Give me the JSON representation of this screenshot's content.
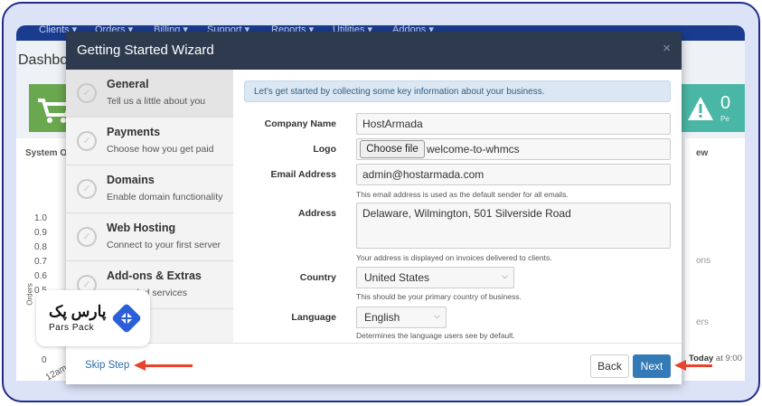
{
  "background": {
    "nav_items": [
      "Clients ▾",
      "Orders ▾",
      "Billing ▾",
      "Support ▾",
      "Reports ▾",
      "Utilities ▾",
      "Addons ▾"
    ],
    "dashboard_title": "Dashboa",
    "system_overview_label": "System O",
    "right_panel_label": "ew",
    "y_axis": [
      "1.0",
      "0.9",
      "0.8",
      "0.7",
      "0.6",
      "0.5"
    ],
    "y_zero": "0",
    "y_axis_title": "Orders",
    "x_first_tick": "12am",
    "right_tile_value": "0",
    "right_tile_sub": "Pe",
    "right_fragments": [
      "ons",
      "ers"
    ],
    "today_label": "Today",
    "today_time": "at 9:00"
  },
  "modal": {
    "title": "Getting Started Wizard",
    "close": "×"
  },
  "steps": [
    {
      "title": "General",
      "desc": "Tell us a little about you",
      "active": true
    },
    {
      "title": "Payments",
      "desc": "Choose how you get paid"
    },
    {
      "title": "Domains",
      "desc": "Enable domain functionality"
    },
    {
      "title": "Web Hosting",
      "desc": "Connect to your first server"
    },
    {
      "title": "Add-ons & Extras",
      "desc": "ded services"
    }
  ],
  "form": {
    "intro": "Let's get started by collecting some key information about your business.",
    "company_label": "Company Name",
    "company_value": "HostArmada",
    "logo_label": "Logo",
    "file_button": "Choose file",
    "file_name": "welcome-to-whmcs",
    "email_label": "Email Address",
    "email_value": "admin@hostarmada.com",
    "email_help": "This email address is used as the default sender for all emails.",
    "address_label": "Address",
    "address_value": "Delaware, Wilmington, 501 Silverside Road",
    "address_help": "Your address is displayed on invoices delivered to clients.",
    "country_label": "Country",
    "country_value": "United States",
    "country_help": "This should be your primary country of business.",
    "language_label": "Language",
    "language_value": "English",
    "language_help": "Determines the language users see by default."
  },
  "footer": {
    "skip": "Skip Step",
    "back": "Back",
    "next": "Next"
  },
  "watermark": {
    "brand_fa": "پارس پک",
    "brand_en": "Pars Pack"
  },
  "colors": {
    "header": "#2e3b4e",
    "primary": "#337ab7",
    "arrow": "#e8442d",
    "frame": "#1f2d8a"
  }
}
